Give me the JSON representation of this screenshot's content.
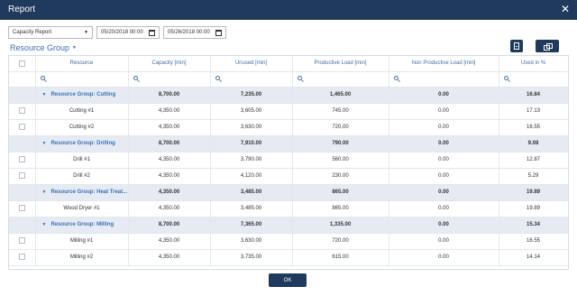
{
  "window": {
    "title": "Report",
    "close_glyph": "✕"
  },
  "toolbar": {
    "report_type": "Capacity Report",
    "date_from": "05/20/2018 00:00",
    "date_to": "05/26/2018 00:00",
    "calendar_icon": "calendar-icon"
  },
  "groupby": {
    "label": "Resource Group"
  },
  "actions": {
    "export_icon": "export-document-icon",
    "columns_icon": "column-chooser-icon"
  },
  "grid": {
    "columns": [
      "Resource",
      "Capacity [min]",
      "Unused [min]",
      "Productive Load [min]",
      "Non Productive Load [min]",
      "Used in %"
    ],
    "groups": [
      {
        "label": "Resource Group: Cutting",
        "capacity": "8,700.00",
        "unused": "7,235.00",
        "productive": "1,465.00",
        "nonproductive": "0.00",
        "used": "16.84",
        "rows": [
          {
            "resource": "Cutting #1",
            "capacity": "4,350.00",
            "unused": "3,605.00",
            "productive": "745.00",
            "nonproductive": "0.00",
            "used": "17.13"
          },
          {
            "resource": "Cutting #2",
            "capacity": "4,350.00",
            "unused": "3,630.00",
            "productive": "720.00",
            "nonproductive": "0.00",
            "used": "16.55"
          }
        ]
      },
      {
        "label": "Resource Group: Drilling",
        "capacity": "8,700.00",
        "unused": "7,910.00",
        "productive": "790.00",
        "nonproductive": "0.00",
        "used": "9.08",
        "rows": [
          {
            "resource": "Drill #1",
            "capacity": "4,350.00",
            "unused": "3,790.00",
            "productive": "560.00",
            "nonproductive": "0.00",
            "used": "12.87"
          },
          {
            "resource": "Drill #2",
            "capacity": "4,350.00",
            "unused": "4,120.00",
            "productive": "230.00",
            "nonproductive": "0.00",
            "used": "5.29"
          }
        ]
      },
      {
        "label": "Resource Group: Heat Treat...",
        "capacity": "4,350.00",
        "unused": "3,485.00",
        "productive": "865.00",
        "nonproductive": "0.00",
        "used": "19.89",
        "rows": [
          {
            "resource": "Wood Dryer #1",
            "capacity": "4,350.00",
            "unused": "3,485.00",
            "productive": "865.00",
            "nonproductive": "0.00",
            "used": "19.89"
          }
        ]
      },
      {
        "label": "Resource Group: Milling",
        "capacity": "8,700.00",
        "unused": "7,365.00",
        "productive": "1,335.00",
        "nonproductive": "0.00",
        "used": "15.34",
        "rows": [
          {
            "resource": "Milling #1",
            "capacity": "4,350.00",
            "unused": "3,630.00",
            "productive": "720.00",
            "nonproductive": "0.00",
            "used": "16.55"
          },
          {
            "resource": "Milling #2",
            "capacity": "4,350.00",
            "unused": "3,735.00",
            "productive": "615.00",
            "nonproductive": "0.00",
            "used": "14.14"
          }
        ]
      }
    ]
  },
  "footer": {
    "ok_label": "OK"
  }
}
